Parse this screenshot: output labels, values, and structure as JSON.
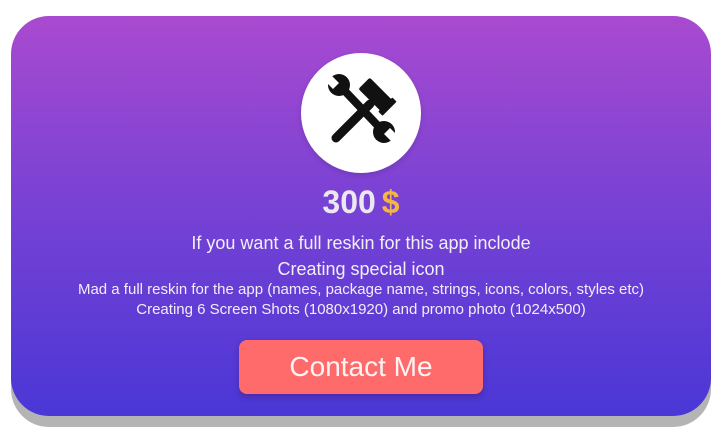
{
  "card": {
    "price_amount": "300",
    "price_currency": "$",
    "lines": [
      "If you want a full reskin for this app inclode",
      "Creating special icon",
      "Mad a full reskin for the app (names, package name, strings, icons, colors, styles etc)",
      "Creating 6 Screen Shots (1080x1920) and promo photo (1024x500)"
    ],
    "contact_label": "Contact Me",
    "icon": "tools-icon"
  },
  "colors": {
    "gradient_top": "#a94ad0",
    "gradient_bottom": "#4a37d6",
    "currency": "#f5b447",
    "button": "#ff6b6b"
  }
}
